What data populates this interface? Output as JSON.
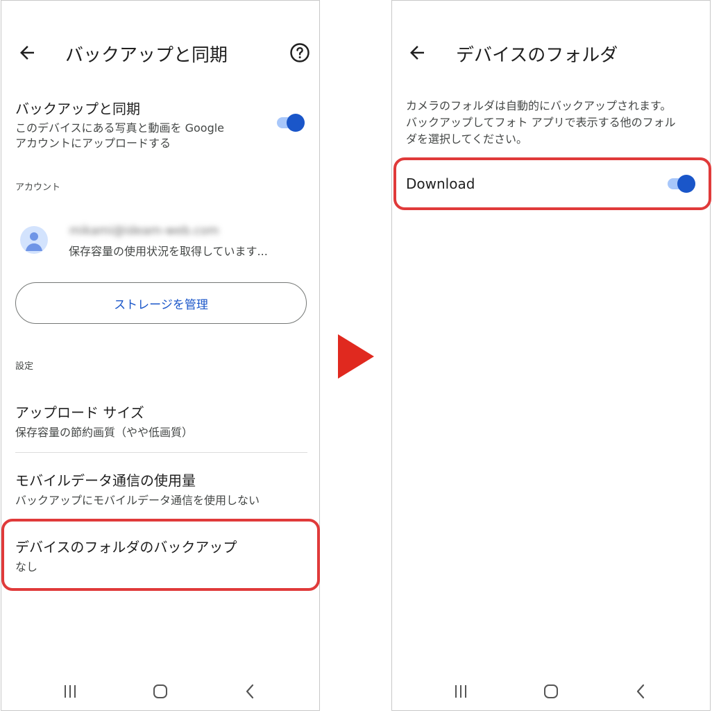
{
  "left_screen": {
    "app_bar": {
      "title": "バックアップと同期",
      "back_icon": "arrow-back-icon",
      "help_icon": "help-circle-icon"
    },
    "backup_sync": {
      "title": "バックアップと同期",
      "subtitle_line1": "このデバイスにある写真と動画を Google",
      "subtitle_line2": "アカウントにアップロードする",
      "toggle_on": true
    },
    "account_section": {
      "label": "アカウント",
      "email_blurred": "mikami@ideam-web.com",
      "storage_status": "保存容量の使用状況を取得しています..."
    },
    "manage_storage_button": "ストレージを管理",
    "settings_section": {
      "label": "設定",
      "items": [
        {
          "title": "アップロード サイズ",
          "subtitle": "保存容量の節約画質（やや低画質）"
        },
        {
          "title": "モバイルデータ通信の使用量",
          "subtitle": "バックアップにモバイルデータ通信を使用しない"
        },
        {
          "title": "デバイスのフォルダのバックアップ",
          "subtitle": "なし"
        }
      ]
    }
  },
  "right_screen": {
    "app_bar": {
      "title": "デバイスのフォルダ",
      "back_icon": "arrow-back-icon"
    },
    "description_line1": "カメラのフォルダは自動的にバックアップされます。",
    "description_line2": "バックアップしてフォト アプリで表示する他のフォル",
    "description_line3": "ダを選択してください。",
    "folders": [
      {
        "name": "Download",
        "toggle_on": true
      }
    ]
  },
  "nav_bar": {
    "icons": [
      "recent-apps-icon",
      "home-icon",
      "back-icon"
    ]
  },
  "colors": {
    "accent": "#1a56c9",
    "toggle_track": "#a8c7fa",
    "highlight_border": "#e03a3a",
    "arrow": "#e0291f"
  }
}
